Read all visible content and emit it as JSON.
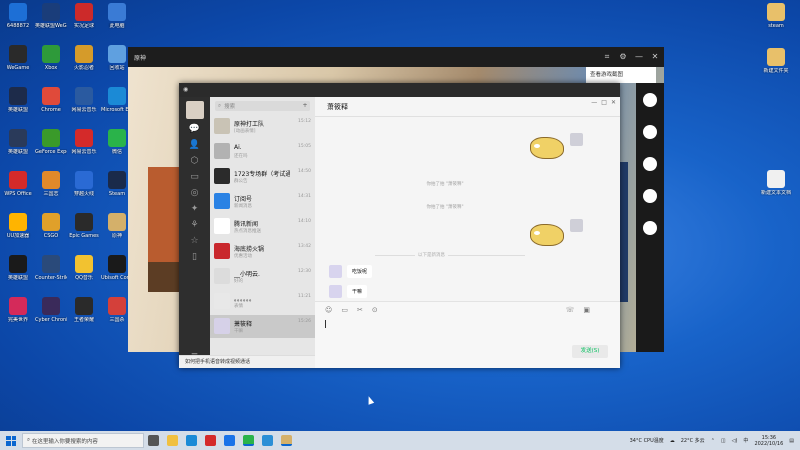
{
  "desktop_left_icons": [
    {
      "label": "6488872",
      "color": "#1d6fd6"
    },
    {
      "label": "英雄联盟WeGame",
      "color": "#1a3d7a"
    },
    {
      "label": "实况足球",
      "color": "#cc2a2a"
    },
    {
      "label": "此电脑",
      "color": "#3a7bd5"
    },
    {
      "label": "WeGame",
      "color": "#2a2a2a"
    },
    {
      "label": "Xbox",
      "color": "#2e9a3a"
    },
    {
      "label": "火影忍者",
      "color": "#d59b2a"
    },
    {
      "label": "回收站",
      "color": "#5fa0e0"
    },
    {
      "label": "英雄联盟",
      "color": "#1d2b4a"
    },
    {
      "label": "Chrome",
      "color": "#e04a3a"
    },
    {
      "label": "网易云音乐",
      "color": "#2a5aa0"
    },
    {
      "label": "Microsoft Edge",
      "color": "#1b8ad6"
    },
    {
      "label": "英雄联盟",
      "color": "#2a3a5a"
    },
    {
      "label": "GeForce Experience",
      "color": "#3a9a2a"
    },
    {
      "label": "网易云音乐",
      "color": "#d42a2a"
    },
    {
      "label": "微信",
      "color": "#2ab34a"
    },
    {
      "label": "WPS Office",
      "color": "#d42a2a"
    },
    {
      "label": "三国志",
      "color": "#e0892a"
    },
    {
      "label": "穿越火线",
      "color": "#2a6ad4"
    },
    {
      "label": "Steam",
      "color": "#1a2a4a"
    },
    {
      "label": "UU加速器",
      "color": "#ffb400"
    },
    {
      "label": "CSGO",
      "color": "#e0a02a"
    },
    {
      "label": "Epic Games",
      "color": "#2a2a2a"
    },
    {
      "label": "原神",
      "color": "#d4b06a"
    },
    {
      "label": "英雄联盟",
      "color": "#1a1a1a"
    },
    {
      "label": "Counter-Strike",
      "color": "#2a4a7a"
    },
    {
      "label": "QQ音乐",
      "color": "#f2c230"
    },
    {
      "label": "Ubisoft Connect",
      "color": "#1a1a1a"
    },
    {
      "label": "完美世界",
      "color": "#d42a5a"
    },
    {
      "label": "Cyber Chronicles",
      "color": "#3a2a5a"
    },
    {
      "label": "王者荣耀",
      "color": "#2a2a2a"
    },
    {
      "label": "三国杀",
      "color": "#d4403a"
    }
  ],
  "desktop_right_icons": [
    {
      "label": "steam",
      "color": "#e8c06a"
    },
    {
      "label": "新建文件夹",
      "color": "#e8c06a"
    },
    {
      "label": "新建文本文档",
      "color": "#f0f0f0"
    }
  ],
  "game_window": {
    "title": "原神",
    "hint_text": "查看游戏截图"
  },
  "wechat": {
    "banner": "如何把手机语音转成视频通话",
    "nav_items": [
      "文件",
      "通讯录",
      "收藏",
      "工具箱",
      "设置"
    ],
    "search_placeholder": "搜索",
    "plus": "+",
    "contacts": [
      {
        "name": "原神打工队",
        "time": "15:12",
        "preview": "[动画表情]",
        "avatar": "#c9c3b5"
      },
      {
        "name": "Ai.",
        "time": "15:05",
        "preview": "还在吗",
        "avatar": "#b2b2b2"
      },
      {
        "name": "1723专场群（考试通知）",
        "time": "14:50",
        "preview": "群公告",
        "avatar": "#2b2b2b"
      },
      {
        "name": "订阅号",
        "time": "14:31",
        "preview": "新闻消息",
        "avatar": "#2a82e4"
      },
      {
        "name": "腾讯新闻",
        "time": "14:10",
        "preview": "热点消息推送",
        "avatar": "#ffffff"
      },
      {
        "name": "海底捞火锅",
        "time": "13:42",
        "preview": "优惠活动",
        "avatar": "#c9282d"
      },
      {
        "name": "__小明云.",
        "time": "12:30",
        "preview": "好的",
        "avatar": "#dcdcdc"
      },
      {
        "name": "。。。。。。",
        "time": "11:21",
        "preview": "表情",
        "avatar": "#e8e8e8"
      },
      {
        "name": "萧筱释",
        "time": "15:26",
        "preview": "干嘛",
        "avatar": "#d6d1e8"
      }
    ],
    "chat_title": "萧筱释",
    "system_messages": [
      "你拍了拍 \"萧筱释\"",
      "你拍了拍 \"萧筱释\""
    ],
    "divider_text": "以下是新消息",
    "messages": [
      {
        "text": "吃饭呢",
        "from": "peer"
      },
      {
        "text": "干嘛",
        "from": "peer"
      }
    ],
    "send_label": "发送(S)",
    "window_controls": [
      "—",
      "□",
      "✕"
    ]
  },
  "taskbar": {
    "search_placeholder": "在这里输入你要搜索的内容",
    "weather": "22°C 多云",
    "cpu": "34°C CPU温度",
    "time": "15:36",
    "date": "2022/10/16"
  }
}
